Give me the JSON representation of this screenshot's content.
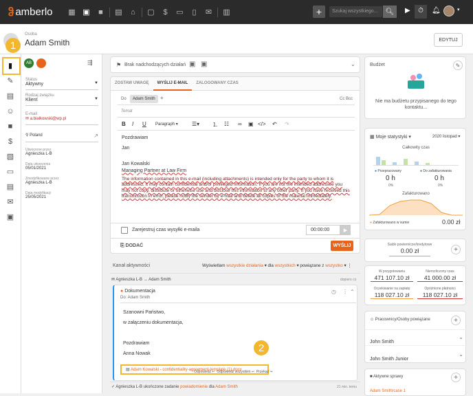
{
  "topbar": {
    "logo": "amberlo",
    "search_placeholder": "Szukaj wszystkiego...",
    "nav_icons": [
      "dashboard-icon",
      "contact-card-icon",
      "briefcase-icon",
      "document-icon",
      "bank-icon",
      "calendar-icon",
      "money-icon",
      "folder-icon",
      "file-icon",
      "mail-icon",
      "table-icon"
    ]
  },
  "header": {
    "contact_label": "Osoba",
    "name": "Adam Smith",
    "edit_button": "EDYTUJ"
  },
  "sidepanel": {
    "avatar_initials": "AB",
    "status_label": "Status",
    "status_value": "Aktywny",
    "relation_label": "Rodzaj związku",
    "relation_value": "Klient",
    "email_label": "E-mail",
    "email_value": "a.bialkowski@wp.pl",
    "country": "Poland",
    "created_by_label": "Utworzone przez",
    "created_by": "Agnieszka L-B",
    "created_date_label": "Data utworzenia",
    "created_date": "05/01/2021",
    "modified_by_label": "Zmodyfikowane przez",
    "modified_by": "Agnieszka L-B",
    "modified_date_label": "Data modyfikacji",
    "modified_date": "25/05/2021"
  },
  "actions_bar": {
    "text": "Brak nadchodzących działań"
  },
  "composer": {
    "tabs": [
      "ZOSTAW UWAGĘ",
      "WYŚLIJ E-MAIL",
      "ZALOGOWANY CZAS"
    ],
    "to_label": "Do",
    "recipient": "Adam Smith",
    "cc_bcc": "Cc  Bcc",
    "subject_placeholder": "Temat",
    "toolbar_paragraph": "Paragraph",
    "body": {
      "greeting": "Pozdrawiam",
      "sign1": "Jan",
      "name": "Jan Kowalski",
      "title": "Managing Partner at Law Firm",
      "disclaimer": "The information contained in this e-mail (including attachments) is intended only for the party to whom it is addressed. It may contain confidential and/or privileged information. If you are not the intended addressee you may not copy, distribute or otherwise use and disclose this information to any other party. If you have received this transmission in error, please notify the sender by e-mail and delete all copies of the material immediately."
    },
    "log_time_label": "Zarejestruj czas wysyłki e-maila",
    "time_value": "00:00:00",
    "attach_label": "DODAĆ",
    "send_label": "WYŚLIJ"
  },
  "activity": {
    "title": "Kanał aktywności",
    "filter_prefix": "Wyświetlam",
    "filter_all": "wszystkie działania",
    "filter_for": "dla",
    "filter_who": "wszystkich",
    "filter_linked": "powiązane z",
    "filter_what": "wszystko",
    "email_route": "Agnieszka L-B → Adam Smith",
    "email_time": "dopiero co",
    "email_subject": "Dokumentacja",
    "email_to": "Do: Adam Smith",
    "email_lines": [
      "Szanowni Państwo,",
      "w załączeniu dokumentacja,",
      "",
      "Pozdrawiam",
      "Anna Nowak"
    ],
    "attachment": "Adam Kowalski - confidentiality-agreement-template (1).docx",
    "footer_actions": [
      "Odpowiedz",
      "Odpowiedz wszystkim",
      "Przekaż"
    ],
    "task_text_pre": "Agnieszka L-B ukończone zadanie",
    "task_link": "powiadomienie",
    "task_for": "dla",
    "task_person": "Adam Smith",
    "task_time": "21 min. temu"
  },
  "right": {
    "budget_title": "Budżet",
    "budget_empty": "Nie ma budżetu przypisanego do tego kontaktu...",
    "stats_title": "Moje statystyki",
    "stats_period": "2020 listopad",
    "total_time": "Całkowity czas",
    "overdue_label": "Przepracowany",
    "unbilled_label": "Do zafakturowania",
    "overdue_value": "0 h",
    "unbilled_value": "0 h",
    "overdue_pct": "0%",
    "unbilled_pct": "0%",
    "billed_title": "Zafakturowano",
    "billed_legend": "Zafakturowano w sumie",
    "billed_value": "0.00 zł",
    "balance_label": "Saldo powiernicze/kredytowe",
    "balance_value": "0.00 zł",
    "invoiced_label": "W przygotowaniu",
    "invoiced_value": "471 107.10 zł",
    "unpaid_label": "Nierozliczony czas",
    "unpaid_value": "41 000.00 zł",
    "pending_label": "Oczekiwanie na zapłatę",
    "pending_value": "118 027.10 zł",
    "overdue_pay_label": "Opóźnione płatności",
    "overdue_pay_value": "118 027.10 zł",
    "related_title": "Pracownicy/Osoby powiązane",
    "related": [
      "John Smith",
      "John Smith Junior"
    ],
    "cases_title": "Aktywne sprawy",
    "case_link": "Adam Smith/case 1"
  },
  "badges": [
    "1",
    "2"
  ],
  "colors": {
    "accent": "#e8641b",
    "badge": "#f3b62f",
    "topbar": "#2b2b2b"
  }
}
